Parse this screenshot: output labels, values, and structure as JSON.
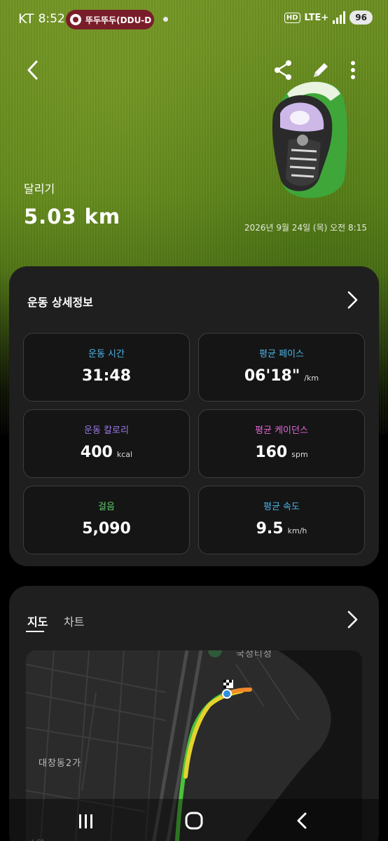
{
  "status_bar": {
    "carrier": "KT",
    "time": "8:52",
    "media_text": "뚜두뚜두(DDU-D",
    "hd": "HD",
    "network": "LTE+",
    "battery": "96"
  },
  "header": {
    "activity_type": "달리기",
    "distance": "5.03 km",
    "date": "2026년 9월 24일 (목) 오전 8:15"
  },
  "details": {
    "title": "운동 상세정보",
    "metrics": [
      {
        "label": "운동 시간",
        "value": "31:48",
        "unit": "",
        "color": "#4cb4e8"
      },
      {
        "label": "평균 페이스",
        "value": "06'18\"",
        "unit": "/km",
        "color": "#4cb4e8"
      },
      {
        "label": "운동 칼로리",
        "value": "400",
        "unit": "kcal",
        "color": "#9c7ae8"
      },
      {
        "label": "평균 케이던스",
        "value": "160",
        "unit": "spm",
        "color": "#e06ad4"
      },
      {
        "label": "걸음",
        "value": "5,090",
        "unit": "",
        "color": "#5bd06a"
      },
      {
        "label": "평균 속도",
        "value": "9.5",
        "unit": "km/h",
        "color": "#4cb4e8"
      }
    ]
  },
  "map_section": {
    "tabs": [
      "지도",
      "차트"
    ],
    "place_label": "대창동2가",
    "top_label": "국정티정",
    "bottom_label": "소양"
  },
  "colors": {
    "card_bg": "#1f1f1f",
    "route_start": "#f28a2b",
    "route_mid": "#e6d22e",
    "route_end": "#4cc23a"
  }
}
